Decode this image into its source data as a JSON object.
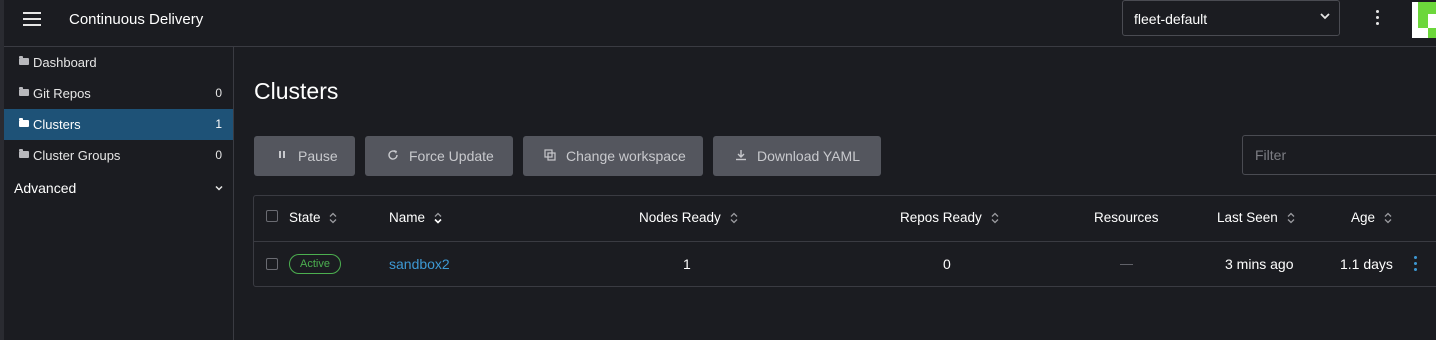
{
  "header": {
    "title": "Continuous Delivery",
    "workspace_selected": "fleet-default"
  },
  "sidebar": {
    "items": [
      {
        "label": "Dashboard",
        "count": ""
      },
      {
        "label": "Git Repos",
        "count": "0"
      },
      {
        "label": "Clusters",
        "count": "1"
      },
      {
        "label": "Cluster Groups",
        "count": "0"
      }
    ],
    "advanced_label": "Advanced"
  },
  "main": {
    "title": "Clusters",
    "buttons": {
      "pause": "Pause",
      "force_update": "Force Update",
      "change_workspace": "Change workspace",
      "download_yaml": "Download YAML"
    },
    "filter_placeholder": "Filter"
  },
  "table": {
    "columns": {
      "state": "State",
      "name": "Name",
      "nodes_ready": "Nodes Ready",
      "repos_ready": "Repos Ready",
      "resources": "Resources",
      "last_seen": "Last Seen",
      "age": "Age"
    },
    "rows": [
      {
        "state": "Active",
        "name": "sandbox2",
        "nodes_ready": "1",
        "repos_ready": "0",
        "resources": "—",
        "last_seen": "3 mins ago",
        "age": "1.1 days"
      }
    ]
  },
  "colors": {
    "accent": "#3d98d3",
    "active_nav": "#1e5277",
    "status_active": "#4caf50",
    "button_bg": "#54565e"
  },
  "icons": {
    "menu": "hamburger-icon",
    "more": "kebab-icon",
    "folder": "folder-icon",
    "pause": "pause-icon",
    "refresh": "refresh-icon",
    "copy": "copy-icon",
    "download": "download-icon"
  }
}
